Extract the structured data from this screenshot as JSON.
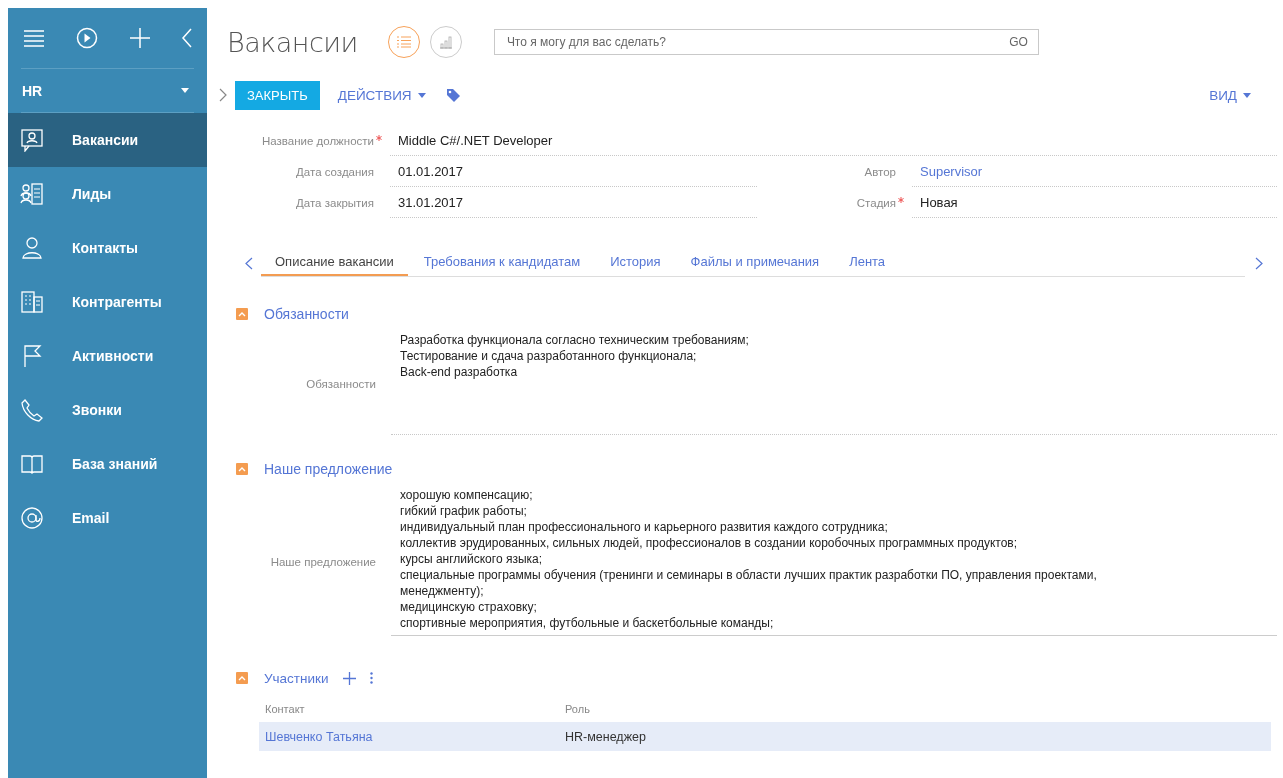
{
  "sidebar": {
    "workplace": "HR",
    "items": [
      {
        "label": "Вакансии",
        "kind": "vacancy",
        "selected": true
      },
      {
        "label": "Лиды",
        "kind": "leads",
        "selected": false
      },
      {
        "label": "Контакты",
        "kind": "person",
        "selected": false
      },
      {
        "label": "Контрагенты",
        "kind": "building",
        "selected": false
      },
      {
        "label": "Активности",
        "kind": "flag",
        "selected": false
      },
      {
        "label": "Звонки",
        "kind": "phone",
        "selected": false
      },
      {
        "label": "База знаний",
        "kind": "book",
        "selected": false
      },
      {
        "label": "Email",
        "kind": "at",
        "selected": false
      }
    ]
  },
  "header": {
    "title": "Вакансии",
    "views": [
      {
        "kind": "list",
        "selected": true
      },
      {
        "kind": "chart",
        "selected": false
      }
    ],
    "search": {
      "placeholder": "Что я могу для вас сделать?",
      "button": "GO"
    }
  },
  "toolbar": {
    "close_button": "ЗАКРЫТЬ",
    "actions_menu": "ДЕЙСТВИЯ",
    "view_menu": "ВИД"
  },
  "field_rows": [
    [
      {
        "label": "Название должности",
        "required": true,
        "value": "Middle C#/.NET Developer",
        "kind": "text"
      }
    ],
    [
      {
        "label": "Дата создания",
        "required": false,
        "value": "01.01.2017",
        "kind": "text"
      },
      {
        "label": "Автор",
        "required": false,
        "value": "Supervisor",
        "kind": "link"
      }
    ],
    [
      {
        "label": "Дата закрытия",
        "required": false,
        "value": "31.01.2017",
        "kind": "text"
      },
      {
        "label": "Стадия",
        "required": true,
        "value": "Новая",
        "kind": "text"
      }
    ]
  ],
  "tabs": [
    {
      "label": "Описание вакансии",
      "selected": true
    },
    {
      "label": "Требования к кандидатам",
      "selected": false
    },
    {
      "label": "История",
      "selected": false
    },
    {
      "label": "Файлы и примечания",
      "selected": false
    },
    {
      "label": "Лента",
      "selected": false
    }
  ],
  "sections": [
    {
      "title": "Обязанности",
      "expanded": true,
      "field_label": "Обязанности",
      "lines": [
        "Разработка функционала согласно техническим требованиям;",
        "Тестирование и сдача разработанного функционала;",
        "Back-end разработка"
      ]
    },
    {
      "title": "Наше предложение",
      "expanded": true,
      "field_label": "Наше предложение",
      "lines": [
        "хорошую компенсацию;",
        "гибкий график работы;",
        "индивидуальный план профессионального и карьерного развития каждого сотрудника;",
        "коллектив эрудированных, сильных людей, профессионалов в создании коробочных программных продуктов;",
        "курсы английского языка;",
        "специальные программы обучения (тренинги и семинары в области лучших практик разработки ПО, управления проектами,",
        "менеджменту);",
        "медицинскую страховку;",
        "спортивные мероприятия, футбольные и баскетбольные команды;"
      ]
    }
  ],
  "participants": {
    "title": "Участники",
    "expanded": true,
    "columns": [
      "Контакт",
      "Роль"
    ],
    "rows": [
      {
        "contact": "Шевченко Татьяна",
        "role": "HR-менеджер",
        "selected": true
      }
    ]
  }
}
